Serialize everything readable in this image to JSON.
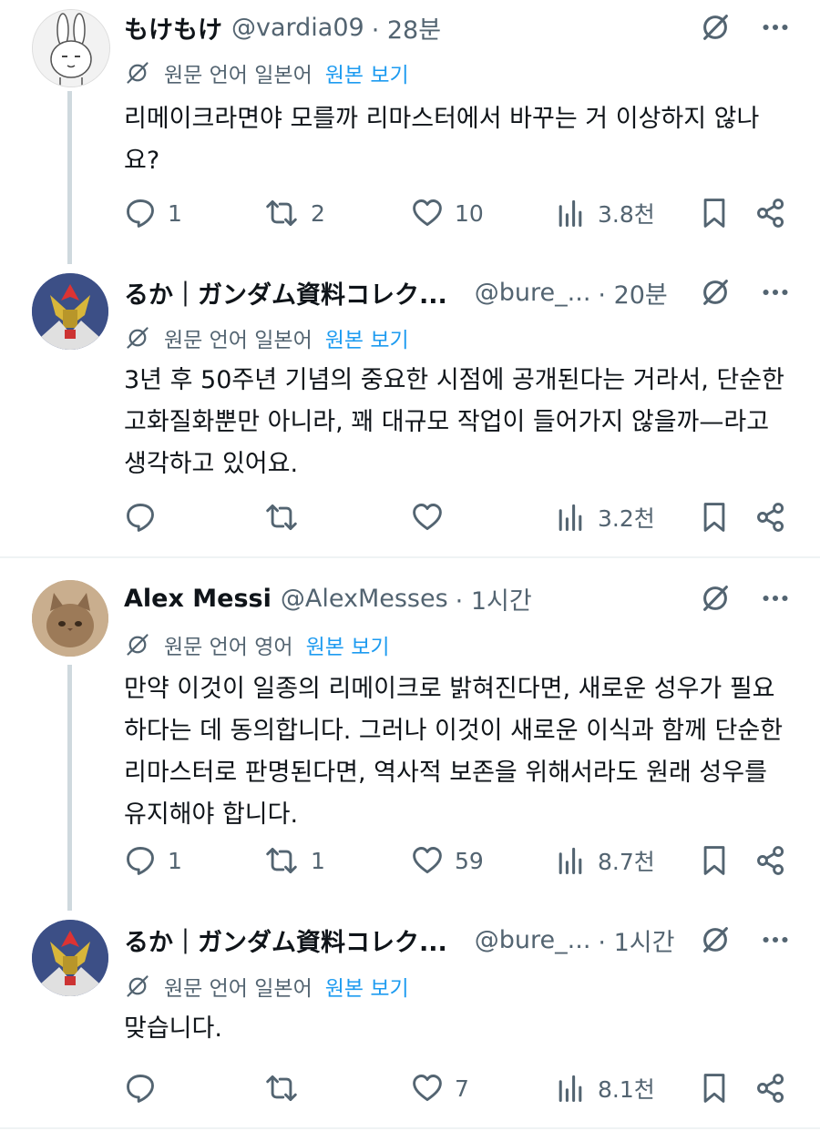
{
  "tweets": [
    {
      "name": "もけもけ",
      "handle": "@vardia09",
      "time": "· 28분",
      "translate": {
        "label": "원문 언어 일본어",
        "link": "원본 보기"
      },
      "text": "리메이크라면야 모를까 리마스터에서 바꾸는 거 이상하지 않나요?",
      "replies": "1",
      "retweets": "2",
      "likes": "10",
      "views": "3.8천"
    },
    {
      "name": "るか｜ガンダム資料コレク...",
      "handle": "@bure_...",
      "time": "· 20분",
      "translate": {
        "label": "원문 언어 일본어",
        "link": "원본 보기"
      },
      "text": "3년 후 50주년 기념의 중요한 시점에 공개된다는 거라서, 단순한 고화질화뿐만 아니라, 꽤 대규모 작업이 들어가지 않을까—라고 생각하고 있어요.",
      "replies": "",
      "retweets": "",
      "likes": "",
      "views": "3.2천"
    },
    {
      "name": "Alex Messi",
      "handle": "@AlexMesses",
      "time": "· 1시간",
      "translate": {
        "label": "원문 언어 영어",
        "link": "원본 보기"
      },
      "text": "만약 이것이 일종의 리메이크로 밝혀진다면, 새로운 성우가 필요하다는 데 동의합니다. 그러나 이것이 새로운 이식과 함께 단순한 리마스터로 판명된다면, 역사적 보존을 위해서라도 원래 성우를 유지해야 합니다.",
      "replies": "1",
      "retweets": "1",
      "likes": "59",
      "views": "8.7천"
    },
    {
      "name": "るか｜ガンダム資料コレク...",
      "handle": "@bure_...",
      "time": "· 1시간",
      "translate": {
        "label": "원문 언어 일본어",
        "link": "원본 보기"
      },
      "text": "맞습니다.",
      "replies": "",
      "retweets": "",
      "likes": "7",
      "views": "8.1천"
    }
  ],
  "icons": {
    "translate": "translate-slash-icon",
    "more": "more-dots-icon",
    "reply": "reply-icon",
    "retweet": "retweet-icon",
    "like": "heart-icon",
    "views": "views-bar-icon",
    "bookmark": "bookmark-icon",
    "share": "share-icon"
  },
  "colors": {
    "link": "#1d9bf0",
    "secondary": "#536471",
    "text": "#0f1419"
  }
}
